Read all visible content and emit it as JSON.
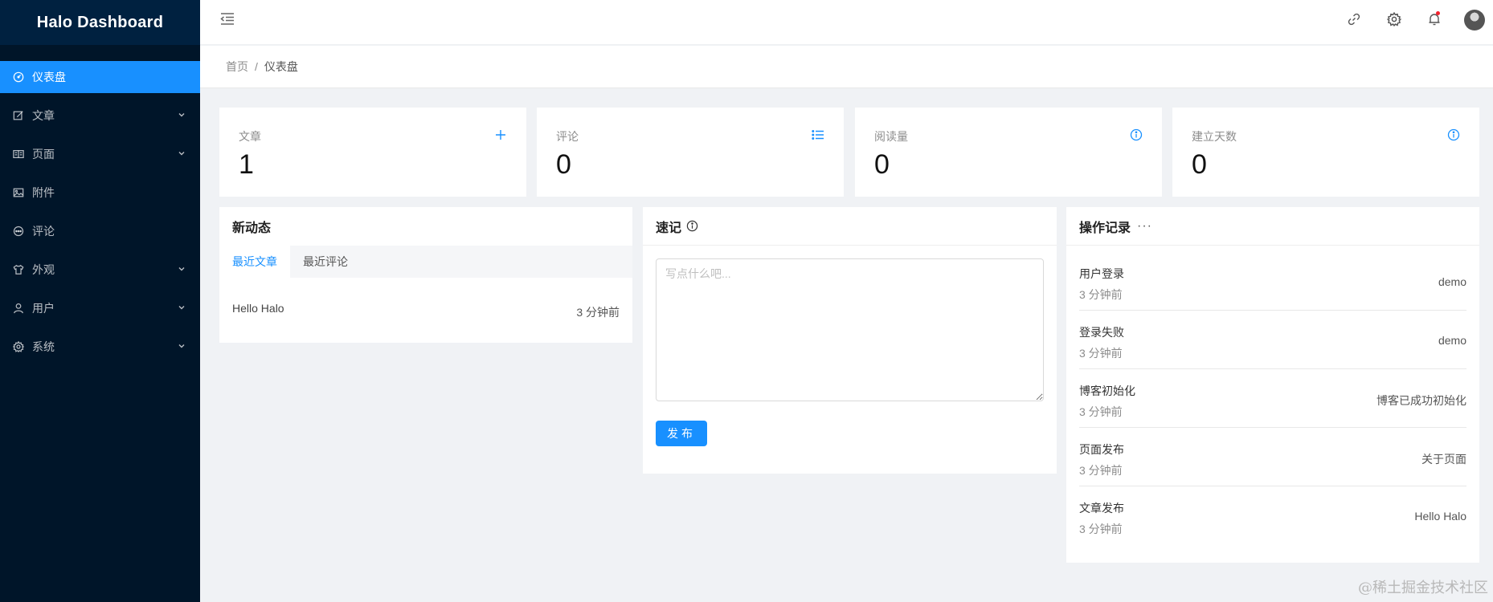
{
  "app": {
    "title": "Halo Dashboard"
  },
  "sidebar": {
    "items": [
      {
        "label": "仪表盘",
        "icon": "dashboard-icon",
        "active": true,
        "expandable": false
      },
      {
        "label": "文章",
        "icon": "edit-icon",
        "active": false,
        "expandable": true
      },
      {
        "label": "页面",
        "icon": "read-icon",
        "active": false,
        "expandable": true
      },
      {
        "label": "附件",
        "icon": "picture-icon",
        "active": false,
        "expandable": false
      },
      {
        "label": "评论",
        "icon": "message-icon",
        "active": false,
        "expandable": false
      },
      {
        "label": "外观",
        "icon": "skin-icon",
        "active": false,
        "expandable": true
      },
      {
        "label": "用户",
        "icon": "user-icon",
        "active": false,
        "expandable": true
      },
      {
        "label": "系统",
        "icon": "setting-icon",
        "active": false,
        "expandable": true
      }
    ]
  },
  "header": {
    "icons": [
      "menu-fold-icon",
      "link-icon",
      "setting-icon",
      "bell-icon",
      "avatar"
    ]
  },
  "breadcrumb": {
    "home": "首页",
    "separator": "/",
    "current": "仪表盘"
  },
  "stats": [
    {
      "label": "文章",
      "value": "1",
      "icon": "plus-icon"
    },
    {
      "label": "评论",
      "value": "0",
      "icon": "unordered-list-icon"
    },
    {
      "label": "阅读量",
      "value": "0",
      "icon": "info-circle-icon"
    },
    {
      "label": "建立天数",
      "value": "0",
      "icon": "info-circle-icon"
    }
  ],
  "activity": {
    "title": "新动态",
    "tabs": [
      "最近文章",
      "最近评论"
    ],
    "active_tab": 0,
    "items": [
      {
        "title": "Hello Halo",
        "time": "3 分钟前"
      }
    ]
  },
  "memo": {
    "title": "速记",
    "placeholder": "写点什么吧...",
    "value": "",
    "button": "发布"
  },
  "logs": {
    "title": "操作记录",
    "more": "···",
    "items": [
      {
        "action": "用户登录",
        "time": "3 分钟前",
        "target": "demo"
      },
      {
        "action": "登录失败",
        "time": "3 分钟前",
        "target": "demo"
      },
      {
        "action": "博客初始化",
        "time": "3 分钟前",
        "target": "博客已成功初始化"
      },
      {
        "action": "页面发布",
        "time": "3 分钟前",
        "target": "关于页面"
      },
      {
        "action": "文章发布",
        "time": "3 分钟前",
        "target": "Hello Halo"
      }
    ]
  },
  "watermark": "@稀土掘金技术社区",
  "colors": {
    "primary": "#1890ff",
    "sidebar_bg": "#001529",
    "sidebar_title_bg": "#002140",
    "page_bg": "#f0f2f5"
  }
}
